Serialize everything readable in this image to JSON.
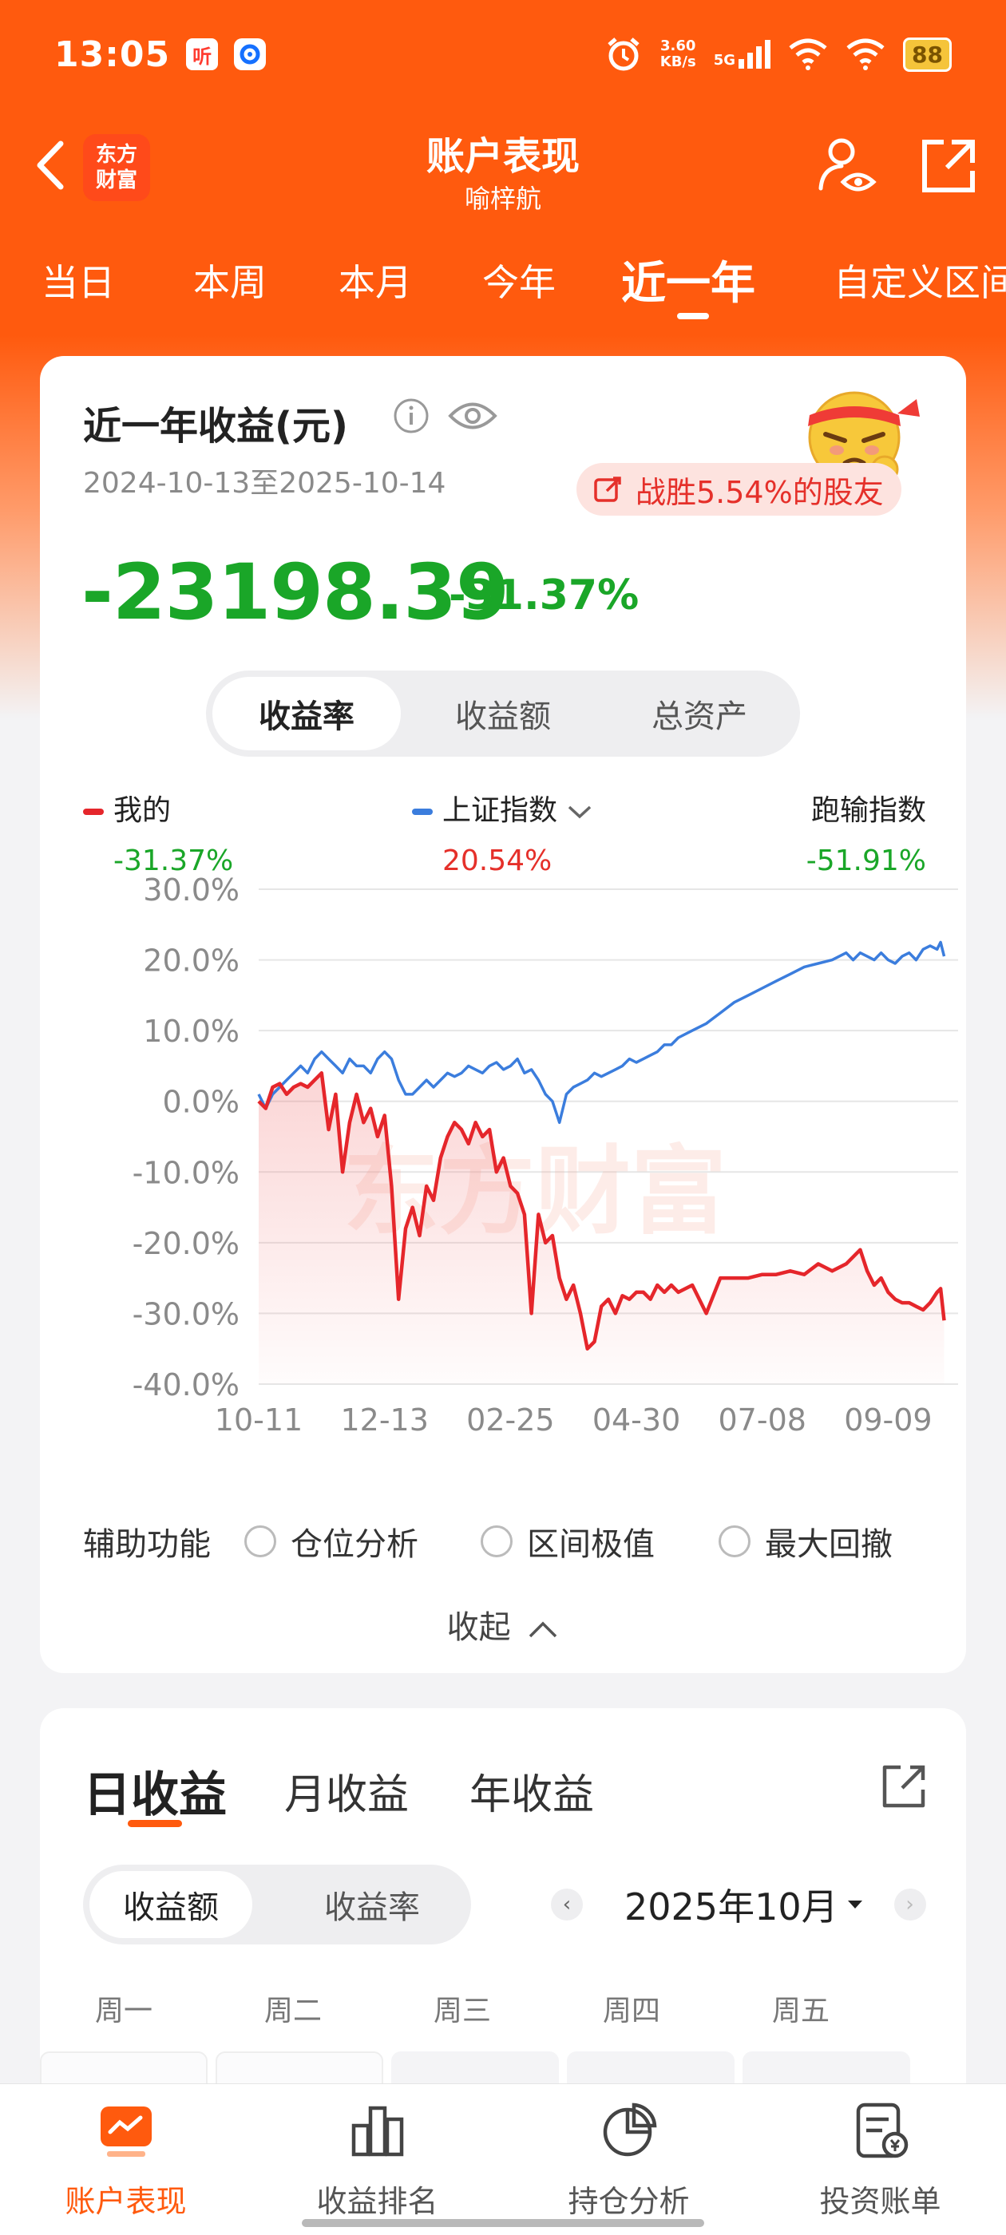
{
  "status_bar": {
    "time": "13:05",
    "app_badge_1": "听",
    "net_speed_value": "3.60",
    "net_speed_unit": "KB/s",
    "network": "5G",
    "battery": "88"
  },
  "header": {
    "logo_line1": "东方",
    "logo_line2": "财富",
    "title": "账户表现",
    "subtitle": "喻梓航"
  },
  "period_tabs": [
    "当日",
    "本周",
    "本月",
    "今年",
    "近一年",
    "自定义区间"
  ],
  "period_active": "近一年",
  "summary": {
    "title": "近一年收益(元)",
    "date_range": "2024-10-13至2025-10-14",
    "beat_text": "战胜5.54%的股友",
    "amount": "-23198.39",
    "pct": "-31.37%"
  },
  "metric_tabs": [
    "收益率",
    "收益额",
    "总资产"
  ],
  "legend": {
    "mine_label": "我的",
    "mine_value": "-31.37%",
    "index_label": "上证指数",
    "index_value": "20.54%",
    "under_label": "跑输指数",
    "under_value": "-51.91%"
  },
  "colors": {
    "brand": "#ff5a0e",
    "mine": "#e5262b",
    "index": "#3b7ddd",
    "gain": "#e5302a",
    "loss": "#1aa628"
  },
  "chart_data": {
    "type": "line",
    "watermark": "东方财富",
    "y_ticks": [
      "30.0%",
      "20.0%",
      "10.0%",
      "0.0%",
      "-10.0%",
      "-20.0%",
      "-30.0%",
      "-40.0%"
    ],
    "ylim": [
      -40,
      30
    ],
    "x_ticks": [
      "10-11",
      "12-13",
      "02-25",
      "04-30",
      "07-08",
      "09-09"
    ],
    "xlim": [
      0,
      100
    ],
    "x_tick_positions": [
      0,
      18,
      36,
      54,
      72,
      90
    ],
    "grid": true,
    "series": [
      {
        "name": "我的",
        "color": "#e5262b",
        "x": [
          0,
          1,
          2,
          3,
          4,
          5,
          6,
          7,
          8,
          9,
          10,
          11,
          12,
          13,
          14,
          15,
          16,
          17,
          18,
          19,
          20,
          21,
          22,
          23,
          24,
          25,
          26,
          27,
          28,
          29,
          30,
          31,
          32,
          33,
          34,
          35,
          36,
          37,
          38,
          39,
          40,
          41,
          42,
          43,
          44,
          45,
          46,
          47,
          48,
          49,
          50,
          51,
          52,
          53,
          54,
          55,
          56,
          57,
          58,
          59,
          60,
          62,
          64,
          66,
          67,
          68,
          70,
          72,
          74,
          76,
          78,
          80,
          82,
          84,
          86,
          87,
          88,
          89,
          90,
          91,
          92,
          93,
          94,
          95,
          96,
          97,
          97.5,
          98
        ],
        "y": [
          0,
          -1,
          2,
          2.5,
          1,
          2,
          2.5,
          2,
          3,
          4,
          -4,
          1,
          -10,
          -3,
          1,
          -3,
          -1,
          -5,
          -2,
          -12,
          -28,
          -18,
          -15,
          -19,
          -12,
          -14,
          -8,
          -5,
          -3,
          -4,
          -6,
          -3,
          -5,
          -4,
          -10,
          -8,
          -12,
          -13,
          -16,
          -30,
          -16,
          -20,
          -19,
          -25,
          -28,
          -26,
          -30,
          -35,
          -34,
          -29,
          -28,
          -30,
          -27.5,
          -28,
          -27,
          -27,
          -28,
          -26,
          -27,
          -26,
          -27,
          -26,
          -30,
          -25,
          -25,
          -25,
          -25,
          -24.5,
          -24.5,
          -24,
          -24.5,
          -23,
          -24,
          -23,
          -21,
          -24,
          -26,
          -25,
          -27,
          -28,
          -28.5,
          -28.5,
          -29,
          -29.5,
          -28.5,
          -27,
          -26.5,
          -31
        ]
      },
      {
        "name": "上证指数",
        "color": "#3b7ddd",
        "x": [
          0,
          1,
          2,
          3,
          4,
          5,
          6,
          7,
          8,
          9,
          10,
          11,
          12,
          13,
          14,
          15,
          16,
          17,
          18,
          19,
          20,
          21,
          22,
          23,
          24,
          25,
          26,
          27,
          28,
          29,
          30,
          31,
          32,
          33,
          34,
          35,
          36,
          37,
          38,
          39,
          40,
          41,
          42,
          43,
          44,
          45,
          46,
          47,
          48,
          49,
          50,
          51,
          52,
          53,
          54,
          55,
          56,
          57,
          58,
          59,
          60,
          62,
          64,
          66,
          68,
          70,
          72,
          74,
          76,
          78,
          80,
          82,
          84,
          85,
          86,
          87,
          88,
          89,
          90,
          91,
          92,
          93,
          94,
          95,
          96,
          97,
          97.5,
          98
        ],
        "y": [
          1,
          -1,
          1,
          2,
          3,
          4,
          5,
          4,
          6,
          7,
          6,
          5,
          4,
          6,
          5,
          5,
          4,
          6,
          7,
          6,
          3,
          1,
          1,
          2,
          3,
          2,
          3,
          4,
          3.5,
          4,
          5,
          4.5,
          4,
          5,
          5.5,
          4.5,
          5,
          6,
          4,
          4.5,
          3,
          1,
          0,
          -3,
          1,
          2,
          2.5,
          3,
          4,
          3.5,
          4,
          4.5,
          5,
          6,
          5.5,
          6,
          6.5,
          7,
          8,
          8,
          9,
          10,
          11,
          12.5,
          14,
          15,
          16,
          17,
          18,
          19,
          19.5,
          20,
          21,
          20,
          21,
          20.5,
          20,
          21,
          20,
          19.5,
          20.5,
          21,
          20,
          21.5,
          22,
          21.5,
          22.5,
          20.5
        ]
      }
    ]
  },
  "aux": {
    "label": "辅助功能",
    "options": [
      "仓位分析",
      "区间极值",
      "最大回撤"
    ],
    "collapse": "收起"
  },
  "earnings": {
    "tabs": [
      "日收益",
      "月收益",
      "年收益"
    ],
    "active_tab": "日收益",
    "metric_tabs": [
      "收益额",
      "收益率"
    ],
    "month": "2025年10月",
    "weekdays": [
      "周一",
      "周二",
      "周三",
      "周四",
      "周五"
    ]
  },
  "bottom_nav": [
    "账户表现",
    "收益排名",
    "持仓分析",
    "投资账单"
  ],
  "bottom_nav_active": "账户表现"
}
